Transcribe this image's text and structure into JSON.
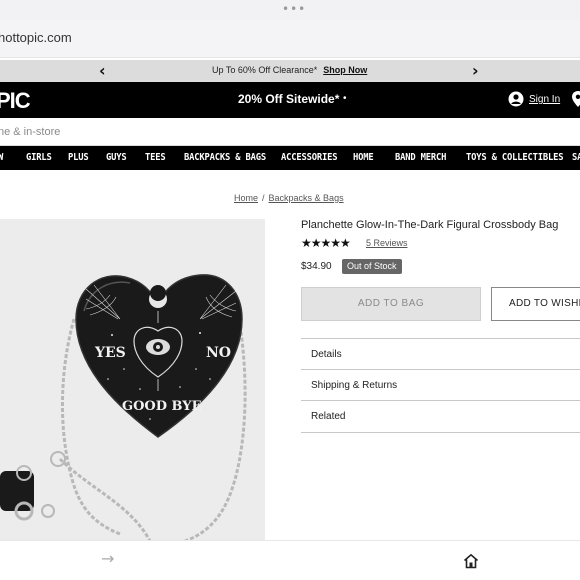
{
  "browser": {
    "menu_dots": "•••",
    "url": "hottopic.com"
  },
  "promo": {
    "prev_icon": "chevron-left-icon",
    "message": "Up To 60% Off Clearance*",
    "link": "Shop Now",
    "next_icon": "chevron-right-icon"
  },
  "header": {
    "logo": "PIC",
    "sitewide": "20% Off Sitewide*",
    "dot": "•",
    "signin": "Sign In",
    "user_icon": "user-icon",
    "store_icon": "location-pin-icon"
  },
  "search": {
    "placeholder": "ne & in-store"
  },
  "nav": {
    "items": [
      "W",
      "GIRLS",
      "PLUS",
      "GUYS",
      "TEES",
      "BACKPACKS & BAGS",
      "ACCESSORIES",
      "HOME",
      "BAND MERCH",
      "TOYS & COLLECTIBLES",
      "SA"
    ]
  },
  "breadcrumb": {
    "home": "Home",
    "sep": "/",
    "category": "Backpacks & Bags"
  },
  "product": {
    "title": "Planchette Glow-In-The-Dark Figural Crossbody Bag",
    "stars": "★★★★★",
    "rating": 5,
    "reviews": "5 Reviews",
    "price": "$34.90",
    "stock": "Out of Stock",
    "add_to_bag": "ADD TO BAG",
    "wishlist": "ADD TO WISHL",
    "accordions": [
      "Details",
      "Shipping & Returns",
      "Related"
    ],
    "image_text": {
      "yes": "YES",
      "no": "NO",
      "goodbye": "GOOD BYE"
    }
  },
  "toolbar": {
    "forward": "→",
    "home_icon": "home-icon"
  },
  "colors": {
    "header_bg": "#000000",
    "promo_bg": "#dcdcdc",
    "oos_badge": "#666666",
    "bag_black": "#1a1a1a"
  }
}
